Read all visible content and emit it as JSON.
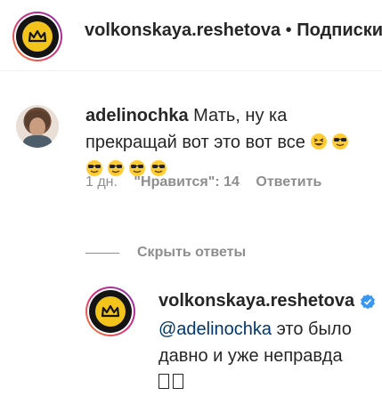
{
  "header": {
    "username": "volkonskaya.reshetova",
    "separator": " • ",
    "follow_label": "Подписки"
  },
  "comment": {
    "username": "adelinochka",
    "text": " Мать, ну ка прекращай вот это вот все ",
    "emojis_inline": [
      "grinning-squint-emoji",
      "sunglasses-emoji"
    ],
    "emojis_line2": [
      "sunglasses-emoji",
      "sunglasses-emoji",
      "sunglasses-emoji",
      "sunglasses-emoji"
    ],
    "time": "1 дн.",
    "likes": "\"Нравится\": 14",
    "reply_label": "Ответить"
  },
  "replies_toggle": {
    "label": "Скрыть ответы"
  },
  "reply": {
    "username": "volkonskaya.reshetova",
    "mention": "@adelinochka",
    "text": " это было давно и уже неправда "
  },
  "colors": {
    "logo_yellow": "#f2c41c",
    "logo_dark": "#141414",
    "verified_blue": "#3897f0",
    "meta_gray": "#8e8e8e",
    "mention_blue": "#00376b"
  }
}
